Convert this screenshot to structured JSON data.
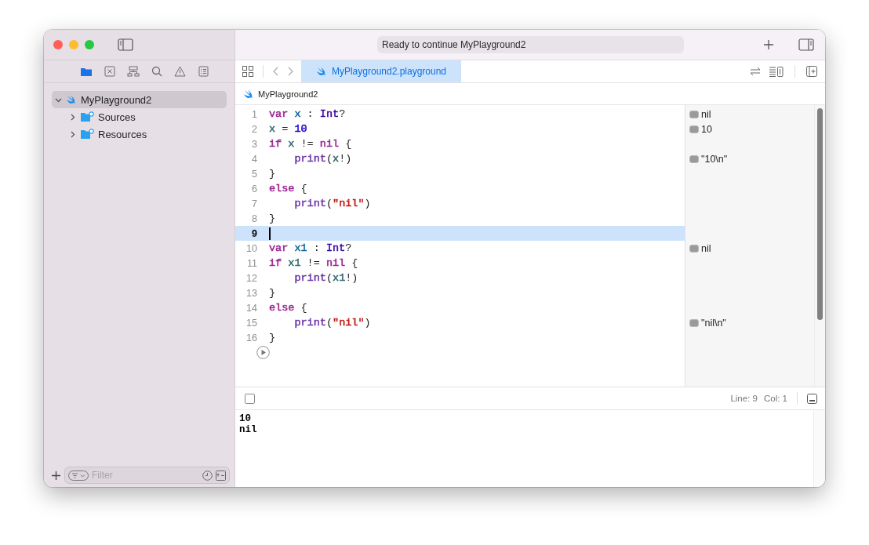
{
  "window": {
    "status": "Ready to continue MyPlayground2"
  },
  "navigator_tabs": [
    {
      "kind": "folder",
      "selected": true
    },
    {
      "kind": "xbox",
      "selected": false
    },
    {
      "kind": "hierarchy",
      "selected": false
    },
    {
      "kind": "search",
      "selected": false
    },
    {
      "kind": "warning",
      "selected": false
    },
    {
      "kind": "list",
      "selected": false
    }
  ],
  "tree": [
    {
      "label": "MyPlayground2",
      "kind": "swift",
      "selected": true,
      "expanded": true,
      "children": [
        {
          "label": "Sources",
          "kind": "folder",
          "selected": false,
          "expanded": false
        },
        {
          "label": "Resources",
          "kind": "folder",
          "selected": false,
          "expanded": false
        }
      ]
    }
  ],
  "filter": {
    "placeholder": "Filter"
  },
  "tabs": [
    {
      "label": "MyPlayground2.playground",
      "selected": true
    }
  ],
  "breadcrumb": "MyPlayground2",
  "lines": [
    {
      "number": "1",
      "selected": false,
      "result": "nil",
      "tokens": [
        {
          "text": "var ",
          "color": "#9b2393"
        },
        {
          "text": "x",
          "color": "#0f68a0"
        },
        {
          "text": " : "
        },
        {
          "text": "Int",
          "color": "#3900a0"
        },
        {
          "text": "?"
        }
      ]
    },
    {
      "number": "2",
      "selected": false,
      "result": "10",
      "tokens": [
        {
          "text": "x",
          "color": "#326d74"
        },
        {
          "text": " = "
        },
        {
          "text": "10",
          "color": "#1c00cf"
        }
      ]
    },
    {
      "number": "3",
      "selected": false,
      "tokens": [
        {
          "text": "if ",
          "color": "#9b2393"
        },
        {
          "text": "x",
          "color": "#326d74"
        },
        {
          "text": " != "
        },
        {
          "text": "nil",
          "color": "#9b2393"
        },
        {
          "text": " {"
        }
      ]
    },
    {
      "number": "4",
      "selected": false,
      "result": "\"10\\n\"",
      "tokens": [
        {
          "text": "    print",
          "color": "#6c36a9"
        },
        {
          "text": "("
        },
        {
          "text": "x",
          "color": "#326d74"
        },
        {
          "text": "!)"
        }
      ]
    },
    {
      "number": "5",
      "selected": false,
      "tokens": [
        {
          "text": "}"
        }
      ]
    },
    {
      "number": "6",
      "selected": false,
      "tokens": [
        {
          "text": "else",
          "color": "#9b2393"
        },
        {
          "text": " {"
        }
      ]
    },
    {
      "number": "7",
      "selected": false,
      "tokens": [
        {
          "text": "    print",
          "color": "#6c36a9"
        },
        {
          "text": "("
        },
        {
          "text": "\"nil\"",
          "color": "#c41a16"
        },
        {
          "text": ")"
        }
      ]
    },
    {
      "number": "8",
      "selected": false,
      "tokens": [
        {
          "text": "}"
        }
      ]
    },
    {
      "number": "9",
      "selected": true
    },
    {
      "number": "10",
      "selected": false,
      "result": "nil",
      "tokens": [
        {
          "text": "var ",
          "color": "#9b2393"
        },
        {
          "text": "x1",
          "color": "#0f68a0"
        },
        {
          "text": " : "
        },
        {
          "text": "Int",
          "color": "#3900a0"
        },
        {
          "text": "?"
        }
      ]
    },
    {
      "number": "11",
      "selected": false,
      "tokens": [
        {
          "text": "if ",
          "color": "#9b2393"
        },
        {
          "text": "x1",
          "color": "#326d74"
        },
        {
          "text": " != "
        },
        {
          "text": "nil",
          "color": "#9b2393"
        },
        {
          "text": " {"
        }
      ]
    },
    {
      "number": "12",
      "selected": false,
      "tokens": [
        {
          "text": "    print",
          "color": "#6c36a9"
        },
        {
          "text": "("
        },
        {
          "text": "x1",
          "color": "#326d74"
        },
        {
          "text": "!)"
        }
      ]
    },
    {
      "number": "13",
      "selected": false,
      "tokens": [
        {
          "text": "}"
        }
      ]
    },
    {
      "number": "14",
      "selected": false,
      "tokens": [
        {
          "text": "else",
          "color": "#9b2393"
        },
        {
          "text": " {"
        }
      ]
    },
    {
      "number": "15",
      "selected": false,
      "result": "\"nil\\n\"",
      "tokens": [
        {
          "text": "    print",
          "color": "#6c36a9"
        },
        {
          "text": "("
        },
        {
          "text": "\"nil\"",
          "color": "#c41a16"
        },
        {
          "text": ")"
        }
      ]
    },
    {
      "number": "16",
      "selected": false,
      "tokens": [
        {
          "text": "}"
        }
      ]
    }
  ],
  "status_bar": {
    "checked": false,
    "line": "Line: 9",
    "col": "Col: 1"
  },
  "console": [
    "10",
    "nil"
  ]
}
